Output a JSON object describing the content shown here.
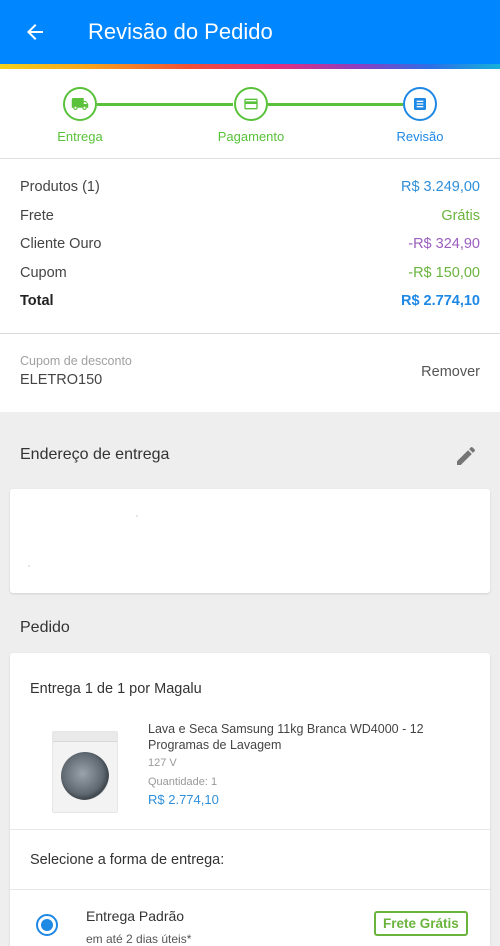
{
  "header": {
    "title": "Revisão do Pedido"
  },
  "stepper": {
    "steps": [
      {
        "label": "Entrega"
      },
      {
        "label": "Pagamento"
      },
      {
        "label": "Revisão"
      }
    ]
  },
  "summary": {
    "rows": [
      {
        "label": "Produtos (1)",
        "value": "R$ 3.249,00"
      },
      {
        "label": "Frete",
        "value": "Grátis"
      },
      {
        "label": "Cliente Ouro",
        "value": "-R$ 324,90"
      },
      {
        "label": "Cupom",
        "value": "-R$ 150,00"
      },
      {
        "label": "Total",
        "value": "R$ 2.774,10"
      }
    ]
  },
  "coupon": {
    "caption": "Cupom de desconto",
    "code": "ELETRO150",
    "remove_label": "Remover"
  },
  "address": {
    "title": "Endereço de entrega"
  },
  "order": {
    "title": "Pedido",
    "delivery_header": "Entrega 1 de 1 por Magalu",
    "product": {
      "name": "Lava e Seca Samsung 11kg Branca WD4000 - 12 Programas de Lavagem",
      "voltage": "127 V",
      "quantity": "Quantidade: 1",
      "price": "R$ 2.774,10"
    },
    "select_label": "Selecione a forma de entrega:",
    "option": {
      "title": "Entrega Padrão",
      "subtitle": "em até 2 dias úteis*",
      "badge": "Frete Grátis"
    }
  },
  "colors": {
    "primary": "#0086ff",
    "step_green": "#59c23a",
    "value_blue": "#2f8fd8",
    "value_green": "#6ab43e",
    "value_purple": "#9b5fc0"
  }
}
